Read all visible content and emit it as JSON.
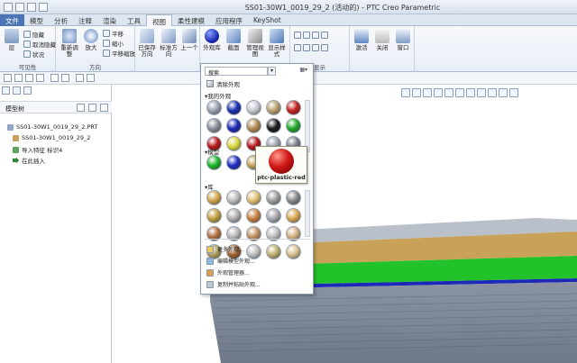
{
  "app": {
    "title": "SS01-30W1_0019_29_2 (活动的) - PTC Creo Parametric"
  },
  "ribbon_tabs": [
    "文件",
    "模型",
    "分析",
    "注释",
    "渲染",
    "工具",
    "视图",
    "柔性建模",
    "应用程序",
    "KeyShot"
  ],
  "active_tab": "视图",
  "ribbon": {
    "groups": {
      "visibility": {
        "caption": "可见性",
        "buttons": [
          "层",
          "隐藏",
          "取消隐藏",
          "状况"
        ]
      },
      "orientation": {
        "caption": "方向",
        "buttons": [
          "重新调整",
          "放大",
          "平移",
          "缩小",
          "平移缩放"
        ]
      },
      "model_display": {
        "buttons": [
          "已保存方向",
          "标准方向",
          "上一个"
        ]
      },
      "appearance": {
        "buttons": [
          "外观库",
          "截面",
          "管理视图",
          "显示样式"
        ]
      },
      "show": {
        "caption": "显示"
      },
      "window": {
        "buttons": [
          "激活",
          "关闭",
          "窗口"
        ]
      }
    }
  },
  "model_tree": {
    "title": "模型树",
    "items": [
      {
        "label": "SS01-30W1_0019_29_2.PRT",
        "icon": "part-icon"
      },
      {
        "label": "SS01-30W1_0019_29_2",
        "icon": "datum-icon"
      },
      {
        "label": "导入特征 标识4",
        "icon": "import-feature-icon"
      },
      {
        "label": "在此插入",
        "icon": "insert-arrow-icon"
      }
    ]
  },
  "appearance_gallery": {
    "search_placeholder": "搜索",
    "clear_label": "清除外观",
    "sections": {
      "my_appearances": "我的外观",
      "model": "模型",
      "library": "库"
    },
    "my_swatches": [
      "#9aa4b0",
      "#1a2fb0",
      "#c9ccd2",
      "#b9a070",
      "#c22020",
      "#8a9098",
      "#1c2ab4",
      "#b08a50",
      "#1a1a1a",
      "#23a82b",
      "#b51818",
      "#d8d840",
      "#b5161a",
      "#9ca4ac",
      "#7a8088"
    ],
    "model_swatches": [
      "#1fb52a",
      "#1f2ec0",
      "#c0a05a"
    ],
    "library_swatches": [
      "#d2a54a",
      "#bdbdbd",
      "#e0c070",
      "#a0a0a0",
      "#8a8a8a",
      "#c0a040",
      "#b0b0b0",
      "#c88040",
      "#a8a8b0",
      "#d8a850",
      "#b07040",
      "#b8b8b8",
      "#c09060",
      "#c0c0c0",
      "#d0b080",
      "#b0a060",
      "#a06030",
      "#c0c0c0",
      "#c0b070",
      "#d8c090"
    ],
    "menu": [
      "更多外观...",
      "编辑模型外观...",
      "外观管理器...",
      "复制并粘贴外观..."
    ]
  },
  "tooltip": {
    "name": "ptc-plastic-red",
    "color": "#d01818"
  },
  "model_colors": {
    "tan": "#c9a25a",
    "green": "#21c22a",
    "blue": "#1c28b8",
    "gray": "#8c96a6"
  }
}
